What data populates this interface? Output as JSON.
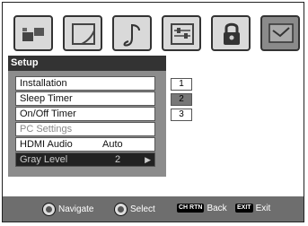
{
  "tabs": [
    {
      "icon": "picture-icon"
    },
    {
      "icon": "screen-shape-icon"
    },
    {
      "icon": "music-note-icon"
    },
    {
      "icon": "sliders-icon"
    },
    {
      "icon": "lock-icon"
    },
    {
      "icon": "setup-icon",
      "active": true
    }
  ],
  "menu": {
    "title": "Setup",
    "items": [
      {
        "label": "Installation"
      },
      {
        "label": "Sleep Timer"
      },
      {
        "label": "On/Off Timer"
      },
      {
        "label": "PC Settings"
      },
      {
        "label": "HDMI Audio",
        "value": "Auto"
      },
      {
        "label": "Gray Level",
        "value": "2"
      }
    ]
  },
  "submenu": {
    "options": [
      "1",
      "2",
      "3"
    ],
    "selected": "2"
  },
  "footer": {
    "navigate": "Navigate",
    "select": "Select",
    "back_key": "CH RTN",
    "back": "Back",
    "exit_key": "EXIT",
    "exit": "Exit"
  }
}
